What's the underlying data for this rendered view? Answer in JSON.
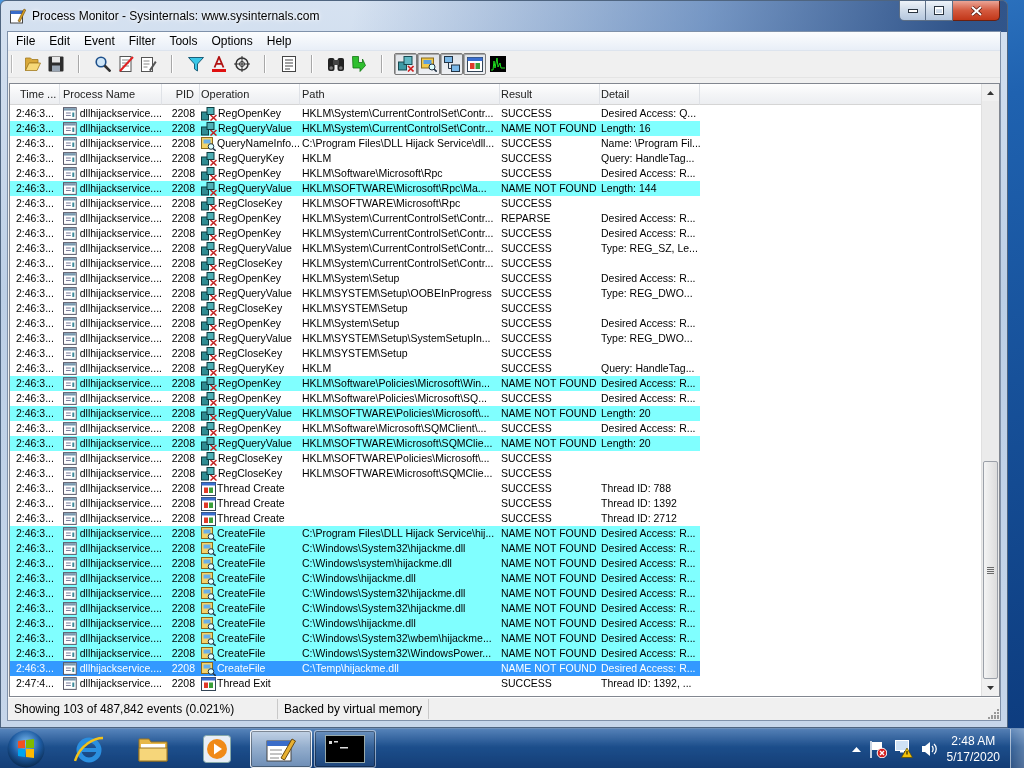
{
  "window": {
    "title": "Process Monitor - Sysinternals: www.sysinternals.com"
  },
  "menu": [
    "File",
    "Edit",
    "Event",
    "Filter",
    "Tools",
    "Options",
    "Help"
  ],
  "toolbar": {
    "event_class_toggles": [
      {
        "on": true
      },
      {
        "on": true
      },
      {
        "on": true
      },
      {
        "on": true
      },
      {
        "on": false
      }
    ]
  },
  "table": {
    "columns": [
      "Time ...",
      "Process Name",
      "PID",
      "Operation",
      "Path",
      "Result",
      "Detail"
    ],
    "rows": [
      {
        "time": "2:46:3...",
        "process": "dllhijackservice....",
        "pid": "2208",
        "kind": "registry",
        "operation": "RegOpenKey",
        "path": "HKLM\\System\\CurrentControlSet\\Contr...",
        "result": "SUCCESS",
        "detail": "Desired Access: Q...",
        "highlighted": false,
        "selected": false
      },
      {
        "time": "2:46:3...",
        "process": "dllhijackservice....",
        "pid": "2208",
        "kind": "registry",
        "operation": "RegQueryValue",
        "path": "HKLM\\System\\CurrentControlSet\\Contr...",
        "result": "NAME NOT FOUND",
        "detail": "Length: 16",
        "highlighted": true,
        "selected": false
      },
      {
        "time": "2:46:3...",
        "process": "dllhijackservice....",
        "pid": "2208",
        "kind": "file",
        "operation": "QueryNameInfo...",
        "path": "C:\\Program Files\\DLL Hijack Service\\dll...",
        "result": "SUCCESS",
        "detail": "Name: \\Program Fil...",
        "highlighted": false,
        "selected": false
      },
      {
        "time": "2:46:3...",
        "process": "dllhijackservice....",
        "pid": "2208",
        "kind": "registry",
        "operation": "RegQueryKey",
        "path": "HKLM",
        "result": "SUCCESS",
        "detail": "Query: HandleTag...",
        "highlighted": false,
        "selected": false
      },
      {
        "time": "2:46:3...",
        "process": "dllhijackservice....",
        "pid": "2208",
        "kind": "registry",
        "operation": "RegOpenKey",
        "path": "HKLM\\Software\\Microsoft\\Rpc",
        "result": "SUCCESS",
        "detail": "Desired Access: R...",
        "highlighted": false,
        "selected": false
      },
      {
        "time": "2:46:3...",
        "process": "dllhijackservice....",
        "pid": "2208",
        "kind": "registry",
        "operation": "RegQueryValue",
        "path": "HKLM\\SOFTWARE\\Microsoft\\Rpc\\Ma...",
        "result": "NAME NOT FOUND",
        "detail": "Length: 144",
        "highlighted": true,
        "selected": false
      },
      {
        "time": "2:46:3...",
        "process": "dllhijackservice....",
        "pid": "2208",
        "kind": "registry",
        "operation": "RegCloseKey",
        "path": "HKLM\\SOFTWARE\\Microsoft\\Rpc",
        "result": "SUCCESS",
        "highlighted": false,
        "selected": false
      },
      {
        "time": "2:46:3...",
        "process": "dllhijackservice....",
        "pid": "2208",
        "kind": "registry",
        "operation": "RegOpenKey",
        "path": "HKLM\\System\\CurrentControlSet\\Contr...",
        "result": "REPARSE",
        "detail": "Desired Access: R...",
        "highlighted": false,
        "selected": false
      },
      {
        "time": "2:46:3...",
        "process": "dllhijackservice....",
        "pid": "2208",
        "kind": "registry",
        "operation": "RegOpenKey",
        "path": "HKLM\\System\\CurrentControlSet\\Contr...",
        "result": "SUCCESS",
        "detail": "Desired Access: R...",
        "highlighted": false,
        "selected": false
      },
      {
        "time": "2:46:3...",
        "process": "dllhijackservice....",
        "pid": "2208",
        "kind": "registry",
        "operation": "RegQueryValue",
        "path": "HKLM\\System\\CurrentControlSet\\Contr...",
        "result": "SUCCESS",
        "detail": "Type: REG_SZ, Le...",
        "highlighted": false,
        "selected": false
      },
      {
        "time": "2:46:3...",
        "process": "dllhijackservice....",
        "pid": "2208",
        "kind": "registry",
        "operation": "RegCloseKey",
        "path": "HKLM\\System\\CurrentControlSet\\Contr...",
        "result": "SUCCESS",
        "highlighted": false,
        "selected": false
      },
      {
        "time": "2:46:3...",
        "process": "dllhijackservice....",
        "pid": "2208",
        "kind": "registry",
        "operation": "RegOpenKey",
        "path": "HKLM\\System\\Setup",
        "result": "SUCCESS",
        "detail": "Desired Access: R...",
        "highlighted": false,
        "selected": false
      },
      {
        "time": "2:46:3...",
        "process": "dllhijackservice....",
        "pid": "2208",
        "kind": "registry",
        "operation": "RegQueryValue",
        "path": "HKLM\\SYSTEM\\Setup\\OOBEInProgress",
        "result": "SUCCESS",
        "detail": "Type: REG_DWO...",
        "highlighted": false,
        "selected": false
      },
      {
        "time": "2:46:3...",
        "process": "dllhijackservice....",
        "pid": "2208",
        "kind": "registry",
        "operation": "RegCloseKey",
        "path": "HKLM\\SYSTEM\\Setup",
        "result": "SUCCESS",
        "highlighted": false,
        "selected": false
      },
      {
        "time": "2:46:3...",
        "process": "dllhijackservice....",
        "pid": "2208",
        "kind": "registry",
        "operation": "RegOpenKey",
        "path": "HKLM\\System\\Setup",
        "result": "SUCCESS",
        "detail": "Desired Access: R...",
        "highlighted": false,
        "selected": false
      },
      {
        "time": "2:46:3...",
        "process": "dllhijackservice....",
        "pid": "2208",
        "kind": "registry",
        "operation": "RegQueryValue",
        "path": "HKLM\\SYSTEM\\Setup\\SystemSetupIn...",
        "result": "SUCCESS",
        "detail": "Type: REG_DWO...",
        "highlighted": false,
        "selected": false
      },
      {
        "time": "2:46:3...",
        "process": "dllhijackservice....",
        "pid": "2208",
        "kind": "registry",
        "operation": "RegCloseKey",
        "path": "HKLM\\SYSTEM\\Setup",
        "result": "SUCCESS",
        "highlighted": false,
        "selected": false
      },
      {
        "time": "2:46:3...",
        "process": "dllhijackservice....",
        "pid": "2208",
        "kind": "registry",
        "operation": "RegQueryKey",
        "path": "HKLM",
        "result": "SUCCESS",
        "detail": "Query: HandleTag...",
        "highlighted": false,
        "selected": false
      },
      {
        "time": "2:46:3...",
        "process": "dllhijackservice....",
        "pid": "2208",
        "kind": "registry",
        "operation": "RegOpenKey",
        "path": "HKLM\\Software\\Policies\\Microsoft\\Win...",
        "result": "NAME NOT FOUND",
        "detail": "Desired Access: R...",
        "highlighted": true,
        "selected": false
      },
      {
        "time": "2:46:3...",
        "process": "dllhijackservice....",
        "pid": "2208",
        "kind": "registry",
        "operation": "RegOpenKey",
        "path": "HKLM\\Software\\Policies\\Microsoft\\SQ...",
        "result": "SUCCESS",
        "detail": "Desired Access: R...",
        "highlighted": false,
        "selected": false
      },
      {
        "time": "2:46:3...",
        "process": "dllhijackservice....",
        "pid": "2208",
        "kind": "registry",
        "operation": "RegQueryValue",
        "path": "HKLM\\SOFTWARE\\Policies\\Microsoft\\...",
        "result": "NAME NOT FOUND",
        "detail": "Length: 20",
        "highlighted": true,
        "selected": false
      },
      {
        "time": "2:46:3...",
        "process": "dllhijackservice....",
        "pid": "2208",
        "kind": "registry",
        "operation": "RegOpenKey",
        "path": "HKLM\\Software\\Microsoft\\SQMClient\\...",
        "result": "SUCCESS",
        "detail": "Desired Access: R...",
        "highlighted": false,
        "selected": false
      },
      {
        "time": "2:46:3...",
        "process": "dllhijackservice....",
        "pid": "2208",
        "kind": "registry",
        "operation": "RegQueryValue",
        "path": "HKLM\\SOFTWARE\\Microsoft\\SQMClie...",
        "result": "NAME NOT FOUND",
        "detail": "Length: 20",
        "highlighted": true,
        "selected": false
      },
      {
        "time": "2:46:3...",
        "process": "dllhijackservice....",
        "pid": "2208",
        "kind": "registry",
        "operation": "RegCloseKey",
        "path": "HKLM\\SOFTWARE\\Policies\\Microsoft\\...",
        "result": "SUCCESS",
        "highlighted": false,
        "selected": false
      },
      {
        "time": "2:46:3...",
        "process": "dllhijackservice....",
        "pid": "2208",
        "kind": "registry",
        "operation": "RegCloseKey",
        "path": "HKLM\\SOFTWARE\\Microsoft\\SQMClie...",
        "result": "SUCCESS",
        "highlighted": false,
        "selected": false
      },
      {
        "time": "2:46:3...",
        "process": "dllhijackservice....",
        "pid": "2208",
        "kind": "thread",
        "operation": "Thread Create",
        "result": "SUCCESS",
        "detail": "Thread ID: 788",
        "highlighted": false,
        "selected": false
      },
      {
        "time": "2:46:3...",
        "process": "dllhijackservice....",
        "pid": "2208",
        "kind": "thread",
        "operation": "Thread Create",
        "result": "SUCCESS",
        "detail": "Thread ID: 1392",
        "highlighted": false,
        "selected": false
      },
      {
        "time": "2:46:3...",
        "process": "dllhijackservice....",
        "pid": "2208",
        "kind": "thread",
        "operation": "Thread Create",
        "result": "SUCCESS",
        "detail": "Thread ID: 2712",
        "highlighted": false,
        "selected": false
      },
      {
        "time": "2:46:3...",
        "process": "dllhijackservice....",
        "pid": "2208",
        "kind": "file",
        "operation": "CreateFile",
        "path": "C:\\Program Files\\DLL Hijack Service\\hij...",
        "result": "NAME NOT FOUND",
        "detail": "Desired Access: R...",
        "highlighted": true,
        "selected": false
      },
      {
        "time": "2:46:3...",
        "process": "dllhijackservice....",
        "pid": "2208",
        "kind": "file",
        "operation": "CreateFile",
        "path": "C:\\Windows\\System32\\hijackme.dll",
        "result": "NAME NOT FOUND",
        "detail": "Desired Access: R...",
        "highlighted": true,
        "selected": false
      },
      {
        "time": "2:46:3...",
        "process": "dllhijackservice....",
        "pid": "2208",
        "kind": "file",
        "operation": "CreateFile",
        "path": "C:\\Windows\\system\\hijackme.dll",
        "result": "NAME NOT FOUND",
        "detail": "Desired Access: R...",
        "highlighted": true,
        "selected": false
      },
      {
        "time": "2:46:3...",
        "process": "dllhijackservice....",
        "pid": "2208",
        "kind": "file",
        "operation": "CreateFile",
        "path": "C:\\Windows\\hijackme.dll",
        "result": "NAME NOT FOUND",
        "detail": "Desired Access: R...",
        "highlighted": true,
        "selected": false
      },
      {
        "time": "2:46:3...",
        "process": "dllhijackservice....",
        "pid": "2208",
        "kind": "file",
        "operation": "CreateFile",
        "path": "C:\\Windows\\System32\\hijackme.dll",
        "result": "NAME NOT FOUND",
        "detail": "Desired Access: R...",
        "highlighted": true,
        "selected": false
      },
      {
        "time": "2:46:3...",
        "process": "dllhijackservice....",
        "pid": "2208",
        "kind": "file",
        "operation": "CreateFile",
        "path": "C:\\Windows\\System32\\hijackme.dll",
        "result": "NAME NOT FOUND",
        "detail": "Desired Access: R...",
        "highlighted": true,
        "selected": false
      },
      {
        "time": "2:46:3...",
        "process": "dllhijackservice....",
        "pid": "2208",
        "kind": "file",
        "operation": "CreateFile",
        "path": "C:\\Windows\\hijackme.dll",
        "result": "NAME NOT FOUND",
        "detail": "Desired Access: R...",
        "highlighted": true,
        "selected": false
      },
      {
        "time": "2:46:3...",
        "process": "dllhijackservice....",
        "pid": "2208",
        "kind": "file",
        "operation": "CreateFile",
        "path": "C:\\Windows\\System32\\wbem\\hijackme...",
        "result": "NAME NOT FOUND",
        "detail": "Desired Access: R...",
        "highlighted": true,
        "selected": false
      },
      {
        "time": "2:46:3...",
        "process": "dllhijackservice....",
        "pid": "2208",
        "kind": "file",
        "operation": "CreateFile",
        "path": "C:\\Windows\\System32\\WindowsPower...",
        "result": "NAME NOT FOUND",
        "detail": "Desired Access: R...",
        "highlighted": true,
        "selected": false
      },
      {
        "time": "2:46:3...",
        "process": "dllhijackservice....",
        "pid": "2208",
        "kind": "file",
        "operation": "CreateFile",
        "path": "C:\\Temp\\hijackme.dll",
        "result": "NAME NOT FOUND",
        "detail": "Desired Access: R...",
        "highlighted": true,
        "selected": true
      },
      {
        "time": "2:47:4...",
        "process": "dllhijackservice....",
        "pid": "2208",
        "kind": "thread",
        "operation": "Thread Exit",
        "result": "SUCCESS",
        "detail": "Thread ID: 1392, ...",
        "highlighted": false,
        "selected": false
      }
    ]
  },
  "status_bar": [
    "Showing 103 of 487,842 events (0.021%)",
    "Backed by virtual memory"
  ],
  "taskbar": {
    "apps": [
      {
        "kind": "browser",
        "running": false,
        "selected": false
      },
      {
        "kind": "folder",
        "running": false,
        "selected": false
      },
      {
        "kind": "media",
        "running": false,
        "selected": false
      },
      {
        "kind": "monitor",
        "running": true,
        "selected": true
      },
      {
        "kind": "terminal",
        "running": true,
        "selected": false
      }
    ],
    "clock": {
      "time": "2:48 AM",
      "date": "5/17/2020"
    }
  }
}
